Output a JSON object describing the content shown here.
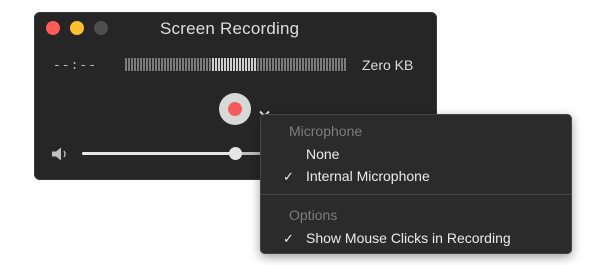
{
  "window": {
    "title": "Screen Recording",
    "time": "--:--",
    "file_size": "Zero KB",
    "volume_fraction": 0.85
  },
  "colors": {
    "window_bg": "#262626",
    "close": "#fc5b57",
    "minimize": "#fcc02e",
    "maximize": "#4e4e4e",
    "record": "#f25d5c",
    "menu_bg": "#2b2b2b"
  },
  "icons": {
    "close": "close-button-icon",
    "minimize": "minimize-button-icon",
    "zoom": "zoom-button-icon",
    "record": "record-icon",
    "options": "chevron-down-icon",
    "volume": "speaker-icon",
    "check": "checkmark-icon"
  },
  "menu": {
    "microphone_header": "Microphone",
    "microphone_items": [
      {
        "label": "None",
        "checked": false
      },
      {
        "label": "Internal Microphone",
        "checked": true
      }
    ],
    "options_header": "Options",
    "options_items": [
      {
        "label": "Show Mouse Clicks in Recording",
        "checked": true
      }
    ],
    "check_glyph": "✓"
  }
}
